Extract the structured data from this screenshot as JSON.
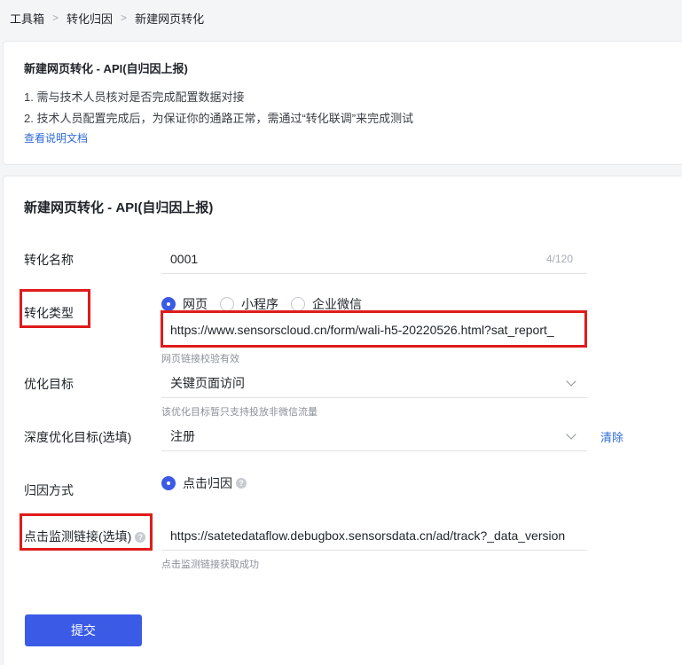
{
  "breadcrumb": {
    "items": [
      "工具箱",
      "转化归因",
      "新建网页转化"
    ],
    "separator": ">"
  },
  "info_card": {
    "title": "新建网页转化 - API(自归因上报)",
    "line1": "1. 需与技术人员核对是否完成配置数据对接",
    "line2": "2. 技术人员配置完成后，为保证你的通路正常，需通过“转化联调”来完成测试",
    "doc_link": "查看说明文档"
  },
  "form": {
    "title": "新建网页转化 - API(自归因上报)",
    "name": {
      "label": "转化名称",
      "value": "0001",
      "counter": "4/120"
    },
    "type": {
      "label": "转化类型",
      "options": [
        "网页",
        "小程序",
        "企业微信"
      ],
      "selected_index": 0,
      "url": "https://www.sensorscloud.cn/form/wali-h5-20220526.html?sat_report_",
      "hint": "网页链接校验有效"
    },
    "goal": {
      "label": "优化目标",
      "value": "关键页面访问",
      "hint": "该优化目标暂只支持投放非微信流量"
    },
    "deep_goal": {
      "label": "深度优化目标(选填)",
      "value": "注册",
      "clear": "清除"
    },
    "attribution": {
      "label": "归因方式",
      "option": "点击归因"
    },
    "monitor": {
      "label": "点击监测链接(选填)",
      "url": "https://satetedataflow.debugbox.sensorsdata.cn/ad/track?_data_version",
      "hint": "点击监测链接获取成功"
    },
    "submit": "提交"
  },
  "colors": {
    "accent": "#3b5be6",
    "link": "#2f6bd6",
    "highlight_box": "#e01b1b"
  }
}
